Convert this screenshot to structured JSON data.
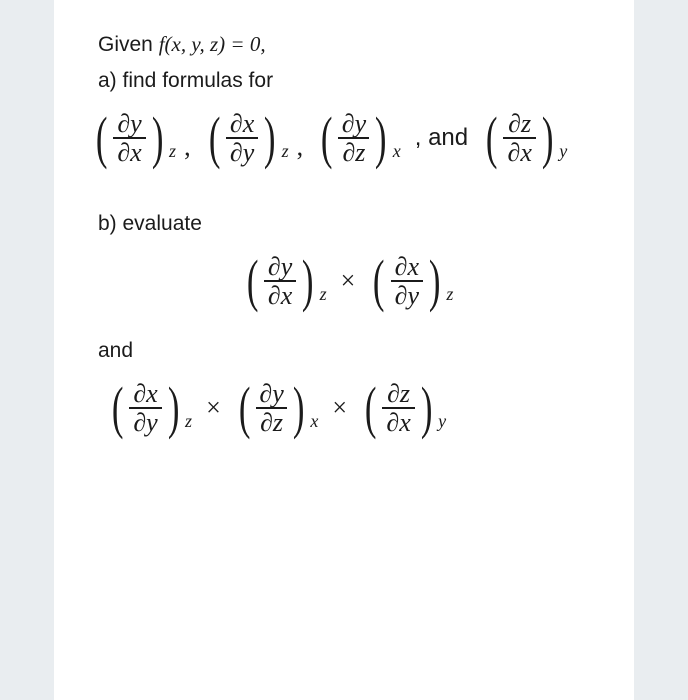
{
  "problem": {
    "given_prefix": "Given ",
    "given_fn": "f(x, y, z) = 0,",
    "part_a": "a) find formulas for",
    "part_b": "b) evaluate",
    "and_word": "and",
    "comma_and": ", and"
  },
  "sym": {
    "d": "∂",
    "x": "x",
    "y": "y",
    "z": "z",
    "times": "×",
    "lp": "(",
    "rp": ")",
    "comma": ","
  },
  "row_a": [
    {
      "num": "y",
      "den": "x",
      "sub": "z",
      "after": "comma"
    },
    {
      "num": "x",
      "den": "y",
      "sub": "z",
      "after": "comma"
    },
    {
      "num": "y",
      "den": "z",
      "sub": "x",
      "after": "and"
    },
    {
      "num": "z",
      "den": "x",
      "sub": "y",
      "after": ""
    }
  ],
  "row_b1": [
    {
      "num": "y",
      "den": "x",
      "sub": "z",
      "after": "times"
    },
    {
      "num": "x",
      "den": "y",
      "sub": "z",
      "after": ""
    }
  ],
  "row_b2": [
    {
      "num": "x",
      "den": "y",
      "sub": "z",
      "after": "times"
    },
    {
      "num": "y",
      "den": "z",
      "sub": "x",
      "after": "times"
    },
    {
      "num": "z",
      "den": "x",
      "sub": "y",
      "after": ""
    }
  ]
}
